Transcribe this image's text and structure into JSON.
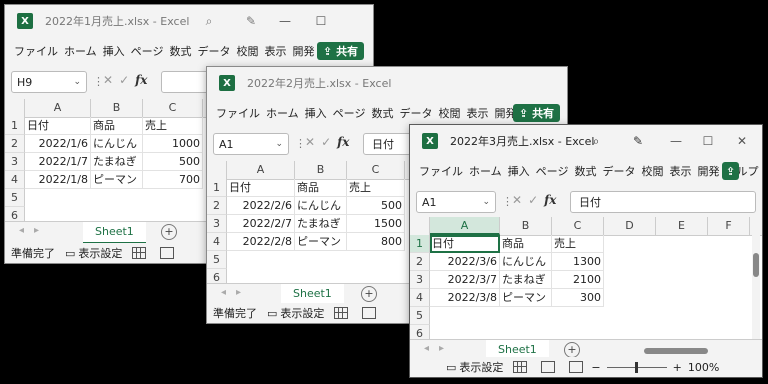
{
  "app_name": "Excel",
  "ribbon_tabs": [
    "ファイル",
    "ホーム",
    "挿入",
    "ページ",
    "数式",
    "データ",
    "校閲",
    "表示",
    "開発",
    "ヘルプ"
  ],
  "share_label": "共有",
  "columns_bg": [
    "A",
    "B",
    "C"
  ],
  "columns_front": [
    "A",
    "B",
    "C",
    "D",
    "E",
    "F"
  ],
  "sheet_name": "Sheet1",
  "status_ready": "準備完了",
  "display_settings": "表示設定",
  "zoom": "100%",
  "window1": {
    "title": "2022年1月売上.xlsx - Excel",
    "cell_ref": "H9",
    "formula_value": "",
    "headers": [
      "日付",
      "商品",
      "売上"
    ],
    "rows": [
      [
        "2022/1/6",
        "にんじん",
        "1000"
      ],
      [
        "2022/1/7",
        "たまねぎ",
        "500"
      ],
      [
        "2022/1/8",
        "ピーマン",
        "700"
      ]
    ]
  },
  "window2": {
    "title": "2022年2月売上.xlsx - Excel",
    "cell_ref": "A1",
    "formula_value": "日付",
    "headers": [
      "日付",
      "商品",
      "売上"
    ],
    "rows": [
      [
        "2022/2/6",
        "にんじん",
        "500"
      ],
      [
        "2022/2/7",
        "たまねぎ",
        "1500"
      ],
      [
        "2022/2/8",
        "ピーマン",
        "800"
      ]
    ]
  },
  "window3": {
    "title": "2022年3月売上.xlsx - Excel",
    "cell_ref": "A1",
    "formula_value": "日付",
    "headers": [
      "日付",
      "商品",
      "売上"
    ],
    "rows": [
      [
        "2022/3/6",
        "にんじん",
        "1300"
      ],
      [
        "2022/3/7",
        "たまねぎ",
        "2100"
      ],
      [
        "2022/3/8",
        "ピーマン",
        "300"
      ]
    ]
  }
}
